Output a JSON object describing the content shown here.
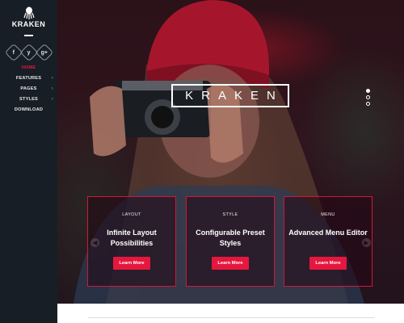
{
  "brand": {
    "name": "KRAKEN",
    "hero_title": "KRAKEN",
    "accent_color": "#e5173e"
  },
  "social": [
    {
      "icon": "facebook-icon",
      "glyph": "f"
    },
    {
      "icon": "twitter-icon",
      "glyph": "y"
    },
    {
      "icon": "google-plus-icon",
      "glyph": "g+"
    }
  ],
  "nav": [
    {
      "label": "HOME",
      "active": true,
      "has_submenu": false
    },
    {
      "label": "FEATURES",
      "active": false,
      "has_submenu": true
    },
    {
      "label": "PAGES",
      "active": false,
      "has_submenu": true
    },
    {
      "label": "STYLES",
      "active": false,
      "has_submenu": true
    },
    {
      "label": "DOWNLOAD",
      "active": false,
      "has_submenu": false
    }
  ],
  "slider": {
    "dots": 3,
    "active_dot": 1
  },
  "cards": [
    {
      "label": "LAYOUT",
      "title": "Infinite Layout Possibilities",
      "button": "Learn More"
    },
    {
      "label": "STYLE",
      "title": "Configurable Preset Styles",
      "button": "Learn More"
    },
    {
      "label": "MENU",
      "title": "Advanced Menu Editor",
      "button": "Learn More"
    }
  ]
}
